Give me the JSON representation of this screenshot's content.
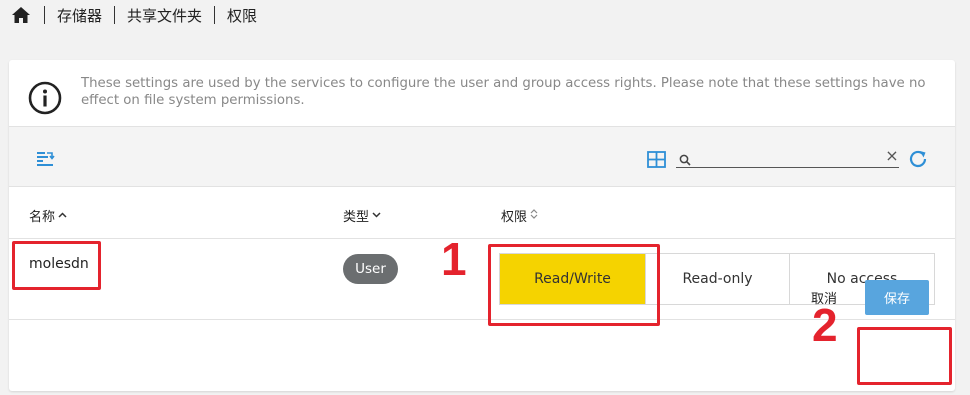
{
  "breadcrumb": {
    "items": [
      "存储器",
      "共享文件夹",
      "权限"
    ]
  },
  "info": {
    "text": "These settings are used by the services to configure the user and group access rights. Please note that these settings have no effect on file system permissions."
  },
  "search": {
    "value": "",
    "placeholder": ""
  },
  "table": {
    "columns": [
      {
        "label": "名称",
        "sort": "asc"
      },
      {
        "label": "类型",
        "sort": "desc"
      },
      {
        "label": "权限",
        "sort": "none"
      }
    ],
    "rows": [
      {
        "name": "molesdn",
        "type": "User",
        "permissions": [
          "Read/Write",
          "Read-only",
          "No access"
        ],
        "selected_permission": "Read/Write"
      }
    ]
  },
  "actions": {
    "cancel_label": "取消",
    "save_label": "保存"
  },
  "annotations": {
    "marker_1": "1",
    "marker_2": "2"
  },
  "colors": {
    "accent": "#58a5de",
    "selected": "#f5d300",
    "annotation": "#e4232d",
    "badge": "#6b6e70"
  }
}
